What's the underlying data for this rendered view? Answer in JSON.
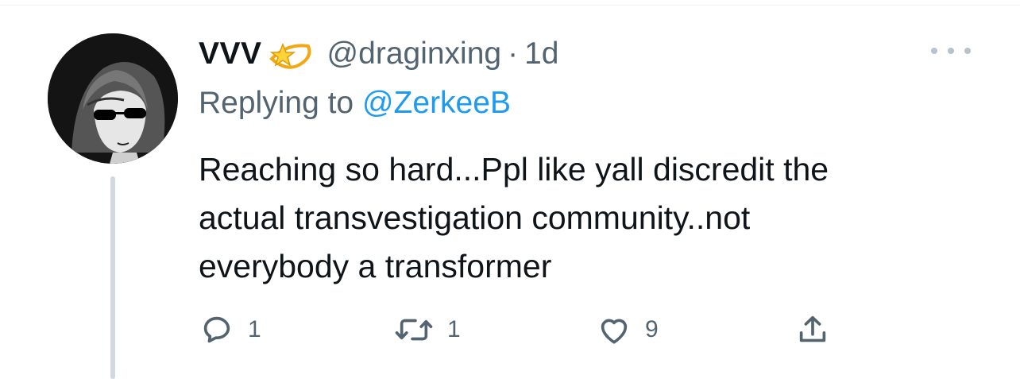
{
  "tweet": {
    "display_name": "VVV",
    "name_emoji": "dizzy-star-emoji",
    "handle": "@draginxing",
    "separator": "·",
    "time": "1d",
    "replying_to_label": "Replying to",
    "replying_to_handle": "@ZerkeeB",
    "text_lines": [
      "Reaching so hard...Ppl like yall discredit the",
      "actual transvestigation community..not",
      "everybody a transformer"
    ],
    "actions": {
      "reply_count": "1",
      "retweet_count": "1",
      "like_count": "9"
    }
  },
  "colors": {
    "text_primary": "#0f1419",
    "text_secondary": "#536471",
    "mention": "#1d9bf0",
    "thread_line": "#cfd9de"
  },
  "icons": [
    "more-icon",
    "reply-icon",
    "retweet-icon",
    "like-icon",
    "share-icon"
  ]
}
